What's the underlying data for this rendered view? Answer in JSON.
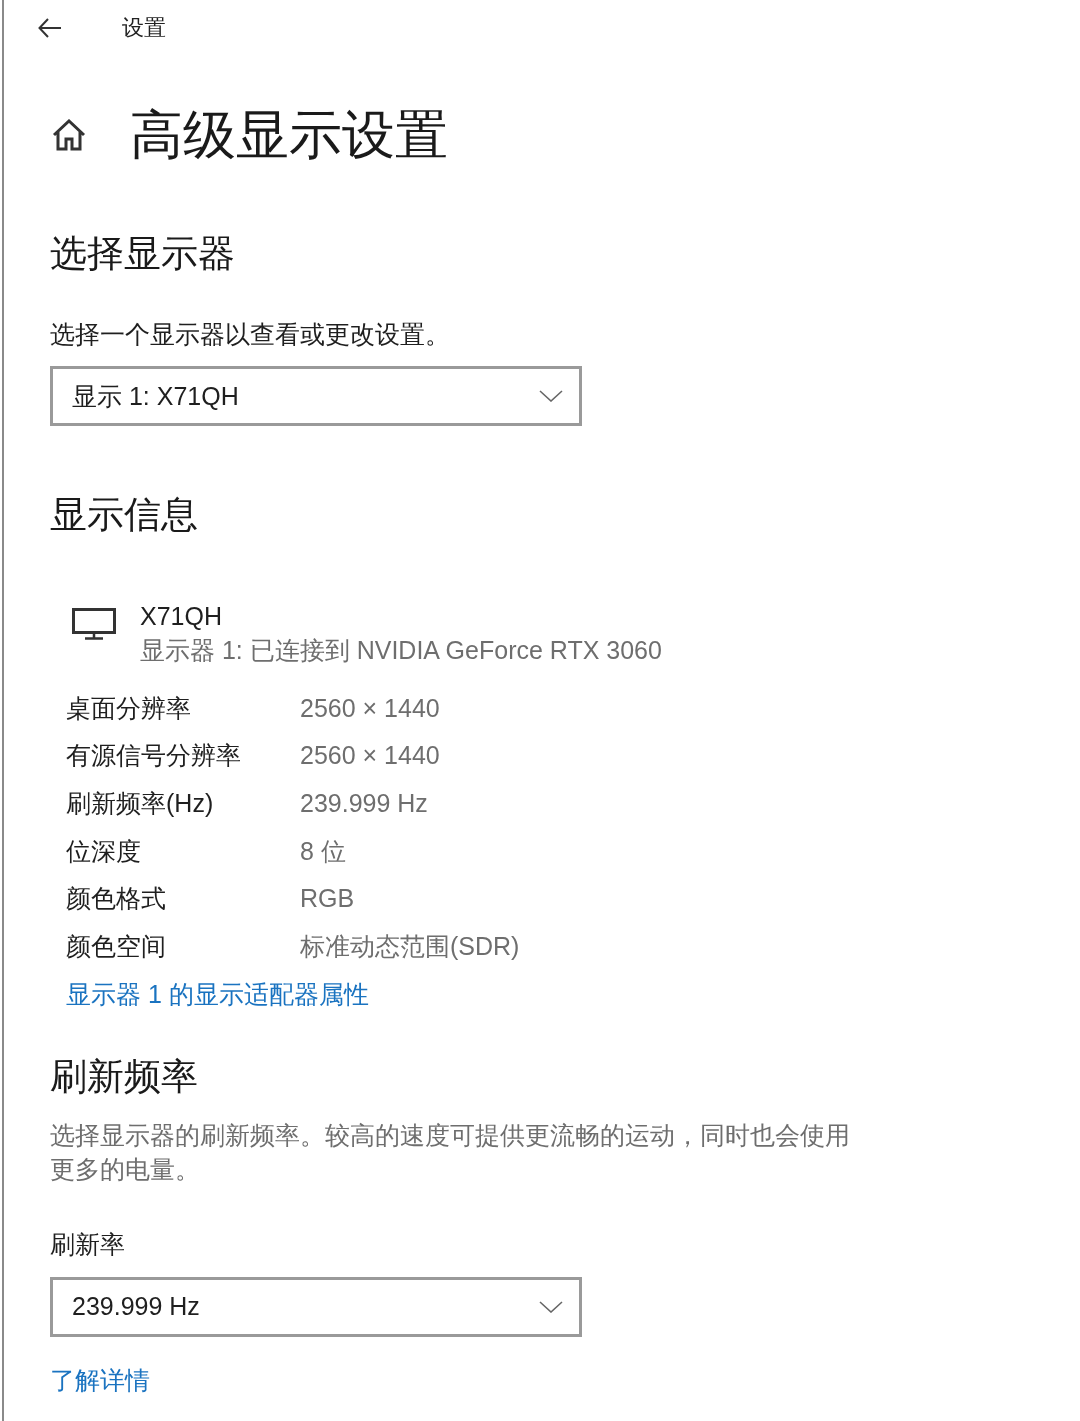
{
  "window": {
    "title": "设置"
  },
  "page": {
    "title": "高级显示设置"
  },
  "select_display": {
    "heading": "选择显示器",
    "description": "选择一个显示器以查看或更改设置。",
    "dropdown": {
      "value": "显示 1: X71QH"
    }
  },
  "display_info": {
    "heading": "显示信息",
    "monitor": {
      "name": "X71QH",
      "subtitle": "显示器 1: 已连接到 NVIDIA GeForce RTX 3060"
    },
    "rows": [
      {
        "label": "桌面分辨率",
        "value": "2560 × 1440"
      },
      {
        "label": "有源信号分辨率",
        "value": "2560 × 1440"
      },
      {
        "label": "刷新频率(Hz)",
        "value": "239.999 Hz"
      },
      {
        "label": "位深度",
        "value": "8 位"
      },
      {
        "label": "颜色格式",
        "value": "RGB"
      },
      {
        "label": "颜色空间",
        "value": "标准动态范围(SDR)"
      }
    ],
    "link": "显示器 1 的显示适配器属性"
  },
  "refresh_rate": {
    "heading": "刷新频率",
    "description": "选择显示器的刷新频率。较高的速度可提供更流畅的运动，同时也会使用更多的电量。",
    "label": "刷新率",
    "dropdown": {
      "value": "239.999 Hz"
    },
    "link": "了解详情"
  }
}
